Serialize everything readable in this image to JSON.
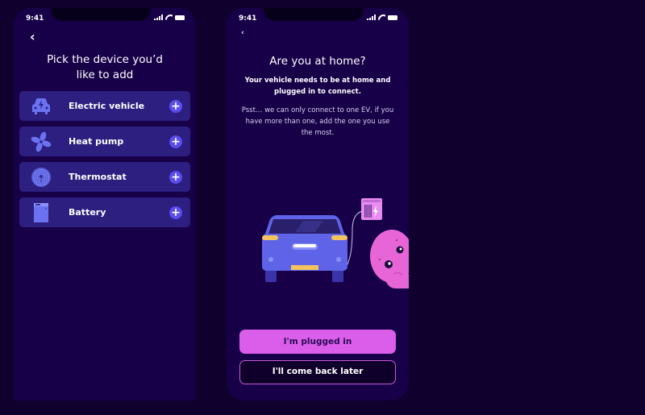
{
  "screens": {
    "pick_device": {
      "status_time": "9:41",
      "back_icon": "chevron-left-icon",
      "title": "Pick the device you’d like to add",
      "devices": [
        {
          "label": "Electric vehicle",
          "icon": "electric-car-icon",
          "action_icon": "plus-icon"
        },
        {
          "label": "Heat pump",
          "icon": "fan-icon",
          "action_icon": "plus-icon"
        },
        {
          "label": "Thermostat",
          "icon": "thermostat-icon",
          "action_icon": "plus-icon"
        },
        {
          "label": "Battery",
          "icon": "battery-unit-icon",
          "action_icon": "plus-icon"
        }
      ],
      "plus_glyph": "+"
    },
    "at_home": {
      "status_time": "9:41",
      "back_icon": "chevron-left-icon",
      "title": "Are you at home?",
      "subtitle": "Your vehicle needs to be at home and plugged in to connect.",
      "note": "Psst… we can only connect to one EV,  if you have more than one, add the one you use the most.",
      "primary_button": "I'm plugged in",
      "secondary_button": "I'll come back later"
    }
  },
  "back_glyph": "‹",
  "colors": {
    "background": "#0f002e",
    "screen": "#170048",
    "card": "#2c1f7f",
    "accent_blue": "#5b4cf0",
    "icon_blue": "#6b72f2",
    "primary_pink": "#db5eea",
    "car_blue": "#5f63e8",
    "mascot_pink": "#e865d8"
  }
}
